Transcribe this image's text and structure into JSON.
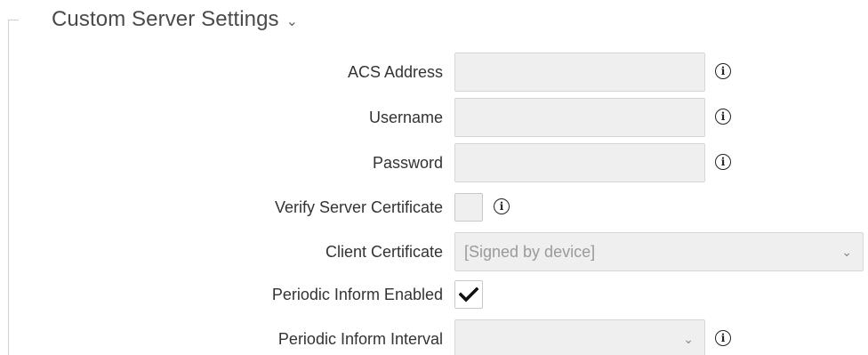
{
  "section": {
    "title": "Custom Server Settings",
    "chevron": "chevron-down-icon"
  },
  "fields": {
    "acs_address": {
      "label": "ACS Address",
      "value": ""
    },
    "username": {
      "label": "Username",
      "value": ""
    },
    "password": {
      "label": "Password",
      "value": ""
    },
    "verify_cert": {
      "label": "Verify Server Certificate",
      "checked": false
    },
    "client_cert": {
      "label": "Client Certificate",
      "value": "[Signed by device]"
    },
    "periodic_enabled": {
      "label": "Periodic Inform Enabled",
      "checked": true
    },
    "periodic_interval": {
      "label": "Periodic Inform Interval",
      "value": ""
    }
  },
  "icons": {
    "info": "info-icon",
    "check": "checkmark-icon"
  },
  "info_glyph": "i",
  "select_arrow": "⌄"
}
